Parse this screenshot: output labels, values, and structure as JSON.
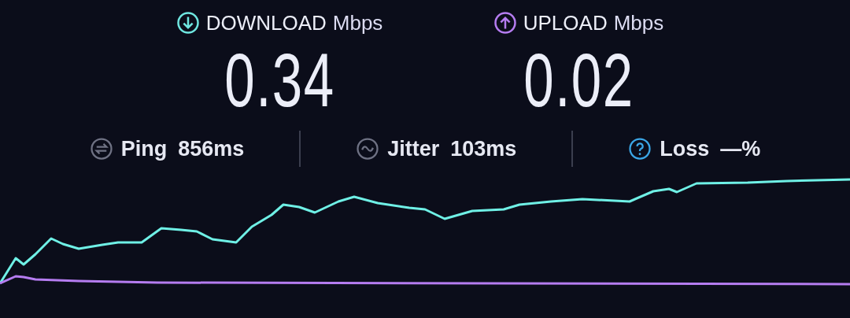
{
  "results": [
    {
      "kind": "download",
      "label": "DOWNLOAD",
      "unit": "Mbps",
      "value": "0.34"
    },
    {
      "kind": "upload",
      "label": "UPLOAD",
      "unit": "Mbps",
      "value": "0.02"
    }
  ],
  "stats": [
    {
      "kind": "ping",
      "label": "Ping",
      "value": "856ms"
    },
    {
      "kind": "jitter",
      "label": "Jitter",
      "value": "103ms"
    },
    {
      "kind": "loss",
      "label": "Loss",
      "value": "—%"
    }
  ]
}
